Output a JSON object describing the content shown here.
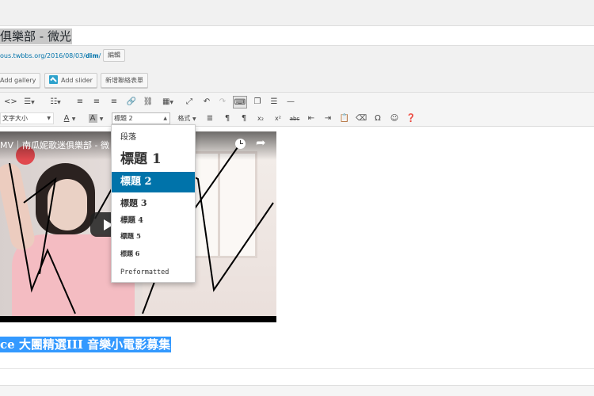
{
  "post": {
    "title": "俱樂部 - 微光",
    "permalink_prefix": "ous.twbbs.org/2016/08/03/",
    "permalink_slug": "dim",
    "permalink_suffix": "/",
    "edit_slug_label": "編輯"
  },
  "media_buttons": [
    {
      "label": "Add gallery"
    },
    {
      "label": "Add slider"
    },
    {
      "label": "新增聯絡表單"
    }
  ],
  "toolbar": {
    "font_size_label": "文字大小",
    "format_label": "標題 2",
    "styles_label": "格式",
    "text_color_glyph": "A",
    "bg_color_glyph": "A",
    "active_button": "keyboard-shortcut-button"
  },
  "video": {
    "title": "MV｜南瓜妮歌迷俱樂部 - 微"
  },
  "content": {
    "highlighted_text": "ce 大團精選III 音樂小電影募集"
  },
  "format_dropdown": {
    "items": [
      {
        "label": "段落",
        "kind": "paragraph"
      },
      {
        "label": "標題 1",
        "kind": "h1"
      },
      {
        "label": "標題 2",
        "kind": "h2",
        "selected": true
      },
      {
        "label": "標題 3",
        "kind": "h3"
      },
      {
        "label": "標題 4",
        "kind": "h4"
      },
      {
        "label": "標題 5",
        "kind": "h5"
      },
      {
        "label": "標題 6",
        "kind": "h6"
      },
      {
        "label": "Preformatted",
        "kind": "pre"
      }
    ]
  },
  "colors": {
    "accent": "#0073aa",
    "selection": "#3399ff",
    "dropdown_active": "#0073aa"
  }
}
